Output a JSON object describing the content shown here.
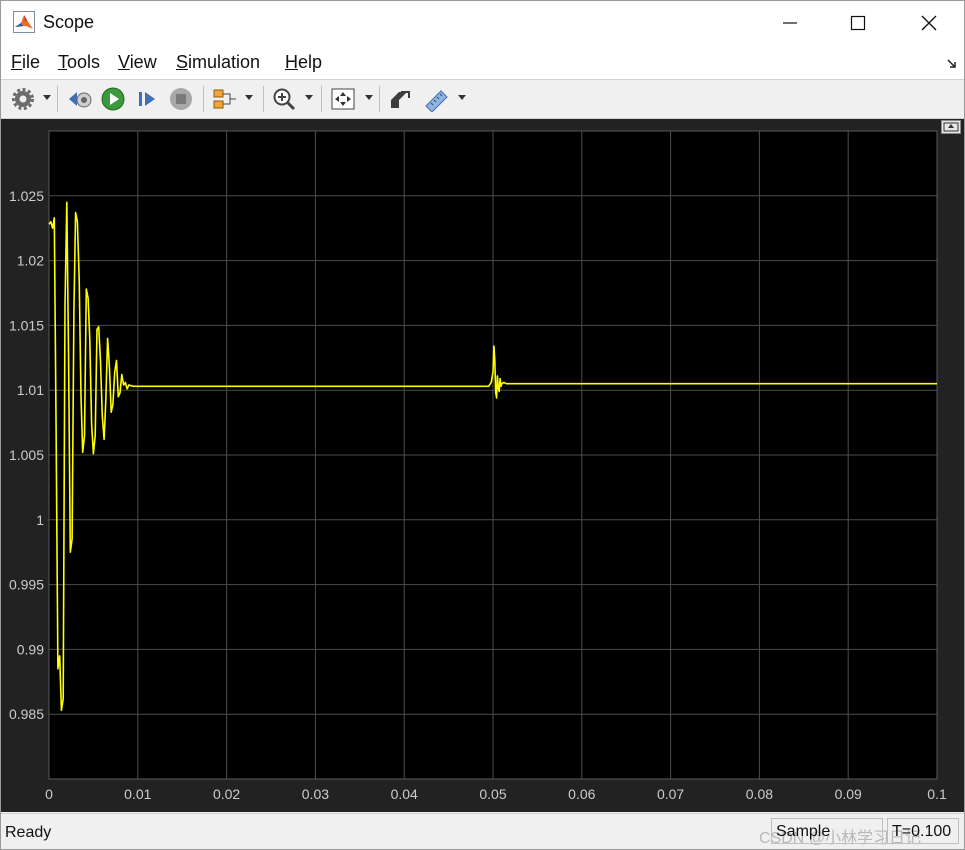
{
  "window": {
    "title": "Scope",
    "controls": {
      "minimize": "minimize",
      "maximize": "maximize",
      "close": "close"
    }
  },
  "menu": [
    {
      "label": "File",
      "access": "F",
      "rest": "ile"
    },
    {
      "label": "Tools",
      "access": "T",
      "rest": "ools"
    },
    {
      "label": "View",
      "access": "V",
      "rest": "iew"
    },
    {
      "label": "Simulation",
      "access": "S",
      "rest": "imulation"
    },
    {
      "label": "Help",
      "access": "H",
      "rest": "elp"
    }
  ],
  "toolbar": {
    "icons": [
      "gear-icon",
      "step-back-icon",
      "run-icon",
      "step-forward-icon",
      "stop-icon",
      "signal-selector-icon",
      "zoom-in-icon",
      "autoscale-icon",
      "style-icon",
      "measure-icon"
    ]
  },
  "status": {
    "ready": "Ready",
    "mode": "Sample based",
    "time": "T=0.100",
    "watermark": "CSDN @小林学习日记"
  },
  "colors": {
    "plot_background": "#000000",
    "figure_background": "#222222",
    "trace": "#ffff00",
    "grid": "#4d4d4d",
    "tick_labels": "#cccccc"
  },
  "chart_data": {
    "type": "line",
    "title": "",
    "xlabel": "",
    "ylabel": "",
    "xlim": [
      0,
      0.1
    ],
    "ylim": [
      0.98,
      1.03
    ],
    "x_ticks": [
      "0",
      "0.01",
      "0.02",
      "0.03",
      "0.04",
      "0.05",
      "0.06",
      "0.07",
      "0.08",
      "0.09",
      "0.1"
    ],
    "y_ticks": [
      "0.985",
      "0.99",
      "0.995",
      "1",
      "1.005",
      "1.01",
      "1.015",
      "1.02",
      "1.025"
    ],
    "grid": true,
    "series": [
      {
        "color": "#ffff00",
        "x": [
          0,
          0.0002,
          0.0004,
          0.0006,
          0.0008,
          0.001,
          0.0012,
          0.0014,
          0.0016,
          0.0018,
          0.002,
          0.0022,
          0.0024,
          0.0026,
          0.0028,
          0.003,
          0.0032,
          0.0034,
          0.0036,
          0.0038,
          0.004,
          0.0042,
          0.0044,
          0.0046,
          0.0048,
          0.005,
          0.0052,
          0.0054,
          0.0056,
          0.0058,
          0.006,
          0.0062,
          0.0064,
          0.0066,
          0.0068,
          0.007,
          0.0072,
          0.0074,
          0.0076,
          0.0078,
          0.008,
          0.0082,
          0.0084,
          0.0086,
          0.0088,
          0.009,
          0.0095,
          0.01,
          0.02,
          0.03,
          0.04,
          0.0495,
          0.0498,
          0.05,
          0.0501,
          0.0502,
          0.0503,
          0.0504,
          0.0505,
          0.0506,
          0.0507,
          0.0508,
          0.0509,
          0.051,
          0.0512,
          0.0515,
          0.052,
          0.06,
          0.07,
          0.08,
          0.09,
          0.1
        ],
        "y": [
          1.0228,
          1.023,
          1.0225,
          1.0233,
          1.007,
          0.9885,
          0.9895,
          0.9853,
          0.9862,
          1.0165,
          1.0245,
          1.013,
          0.9975,
          0.9985,
          1.016,
          1.0237,
          1.023,
          1.0185,
          1.0095,
          1.0052,
          1.0065,
          1.0178,
          1.0171,
          1.0139,
          1.0074,
          1.0051,
          1.0065,
          1.0147,
          1.0149,
          1.0122,
          1.008,
          1.0062,
          1.0092,
          1.014,
          1.0118,
          1.0083,
          1.0089,
          1.0114,
          1.0123,
          1.0095,
          1.0098,
          1.0112,
          1.0104,
          1.0106,
          1.0101,
          1.0104,
          1.0103,
          1.0103,
          1.0103,
          1.0103,
          1.0103,
          1.0103,
          1.0106,
          1.0114,
          1.0134,
          1.0123,
          1.0098,
          1.0094,
          1.0111,
          1.0102,
          1.0099,
          1.0109,
          1.0103,
          1.0105,
          1.0106,
          1.0105,
          1.0105,
          1.0105,
          1.0105,
          1.0105,
          1.0105,
          1.0105
        ]
      }
    ]
  }
}
